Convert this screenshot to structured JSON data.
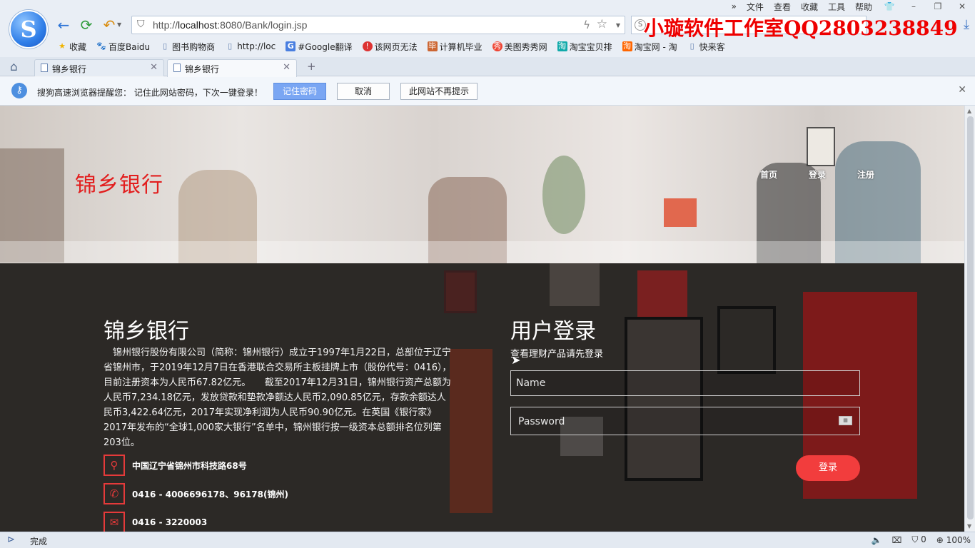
{
  "browser": {
    "menu": [
      "文件",
      "查看",
      "收藏",
      "工具",
      "帮助"
    ],
    "address": {
      "scheme": "http://",
      "host": "localhost",
      "rest": ":8080/Bank/login.jsp"
    },
    "watermark": "小璇软件工作室QQ2803238849",
    "bookmarks": [
      {
        "label": "收藏",
        "icon": "star-icon",
        "color": "#f0b400"
      },
      {
        "label": "百度Baidu",
        "icon": "paw-icon",
        "color": "#3a6fd8"
      },
      {
        "label": "图书购物商",
        "icon": "page-icon",
        "color": "#6a86b3"
      },
      {
        "label": "http://loc",
        "icon": "page-icon",
        "color": "#6a86b3"
      },
      {
        "label": "#Google翻译",
        "icon": "google-translate-icon",
        "color": "#4a7fe0"
      },
      {
        "label": "该网页无法",
        "icon": "error-icon",
        "color": "#d33"
      },
      {
        "label": "计算机毕业",
        "icon": "graduate-icon",
        "color": "#c63"
      },
      {
        "label": "美图秀秀网",
        "icon": "meitu-icon",
        "color": "#e43"
      },
      {
        "label": "淘宝宝贝排",
        "icon": "taobao-icon",
        "color": "#1aa"
      },
      {
        "label": "淘宝网 - 淘",
        "icon": "taobao-icon",
        "color": "#f60"
      },
      {
        "label": "快来客",
        "icon": "page-icon",
        "color": "#6a86b3"
      }
    ],
    "tabs": [
      {
        "title": "锦乡银行",
        "active": false
      },
      {
        "title": "锦乡银行",
        "active": true
      }
    ],
    "notification": {
      "text": "搜狗高速浏览器提醒您： 记住此网站密码，下次一键登录！",
      "remember": "记住密码",
      "cancel": "取消",
      "never": "此网站不再提示"
    },
    "status": {
      "text": "完成",
      "count": "0",
      "zoom": "100%"
    }
  },
  "page": {
    "brand": "锦乡银行",
    "nav": [
      "首页",
      "登录",
      "注册"
    ],
    "about": {
      "title": "锦乡银行",
      "text": "锦州银行股份有限公司（简称：锦州银行）成立于1997年1月22日，总部位于辽宁省锦州市，于2019年12月7日在香港联合交易所主板挂牌上市（股份代号：0416），目前注册资本为人民币67.82亿元。　　截至2017年12月31日，锦州银行资产总额为人民币7,234.18亿元，发放贷款和垫款净额达人民币2,090.85亿元，存款余额达人民币3,422.64亿元，2017年实现净利润为人民币90.90亿元。在英国《银行家》2017年发布的“全球1,000家大银行”名单中，锦州银行按一级资本总额排名位列第203位。"
    },
    "contacts": [
      {
        "icon": "location-pin-icon",
        "text": "中国辽宁省锦州市科技路68号"
      },
      {
        "icon": "phone-icon",
        "text": "0416 - 4006696178、96178(锦州)"
      },
      {
        "icon": "mail-icon",
        "text": "0416 - 3220003"
      }
    ],
    "login": {
      "title": "用户登录",
      "subtitle": "查看理财产品请先登录",
      "name_placeholder": "Name",
      "password_placeholder": "Password",
      "submit": "登录"
    }
  },
  "colors": {
    "brand_red": "#e21e1e",
    "button_red": "#f23d3d",
    "watermark_red": "#ee0000"
  }
}
